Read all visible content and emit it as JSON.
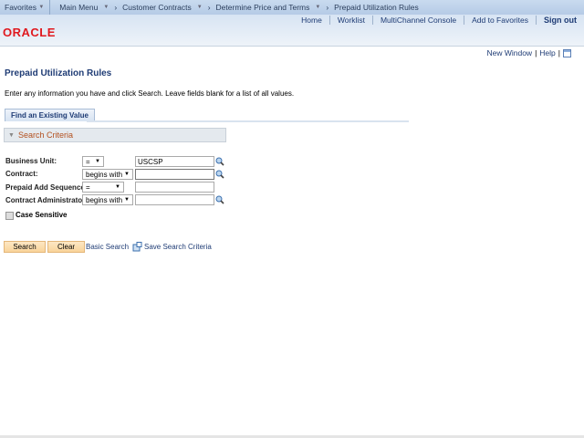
{
  "topbar": {
    "favorites": "Favorites",
    "breadcrumbs": [
      "Main Menu",
      "Customer Contracts",
      "Determine Price and Terms",
      "Prepaid Utilization Rules"
    ]
  },
  "header": {
    "logo": "ORACLE",
    "links": [
      "Home",
      "Worklist",
      "MultiChannel Console",
      "Add to Favorites"
    ],
    "signout": "Sign out"
  },
  "util": {
    "new_window": "New Window",
    "help": "Help",
    "sep": "|"
  },
  "page": {
    "title": "Prepaid Utilization Rules",
    "instructions": "Enter any information you have and click Search. Leave fields blank for a list of all values.",
    "tab": "Find an Existing Value",
    "section": "Search Criteria"
  },
  "fields": [
    {
      "label": "Business Unit:",
      "operator": "=",
      "value": "USCSP"
    },
    {
      "label": "Contract:",
      "operator": "begins with",
      "value": ""
    },
    {
      "label": "Prepaid Add Sequence:",
      "operator": "=",
      "value": ""
    },
    {
      "label": "Contract Administrator:",
      "operator": "begins with",
      "value": ""
    }
  ],
  "case_sensitive": {
    "label": "Case Sensitive",
    "checked": false
  },
  "actions": {
    "search": "Search",
    "clear": "Clear",
    "basic_search": "Basic Search",
    "save_criteria": "Save Search Criteria"
  },
  "colors": {
    "accent": "#1f3c75",
    "logo": "#e0191f",
    "section": "#b3501f"
  }
}
